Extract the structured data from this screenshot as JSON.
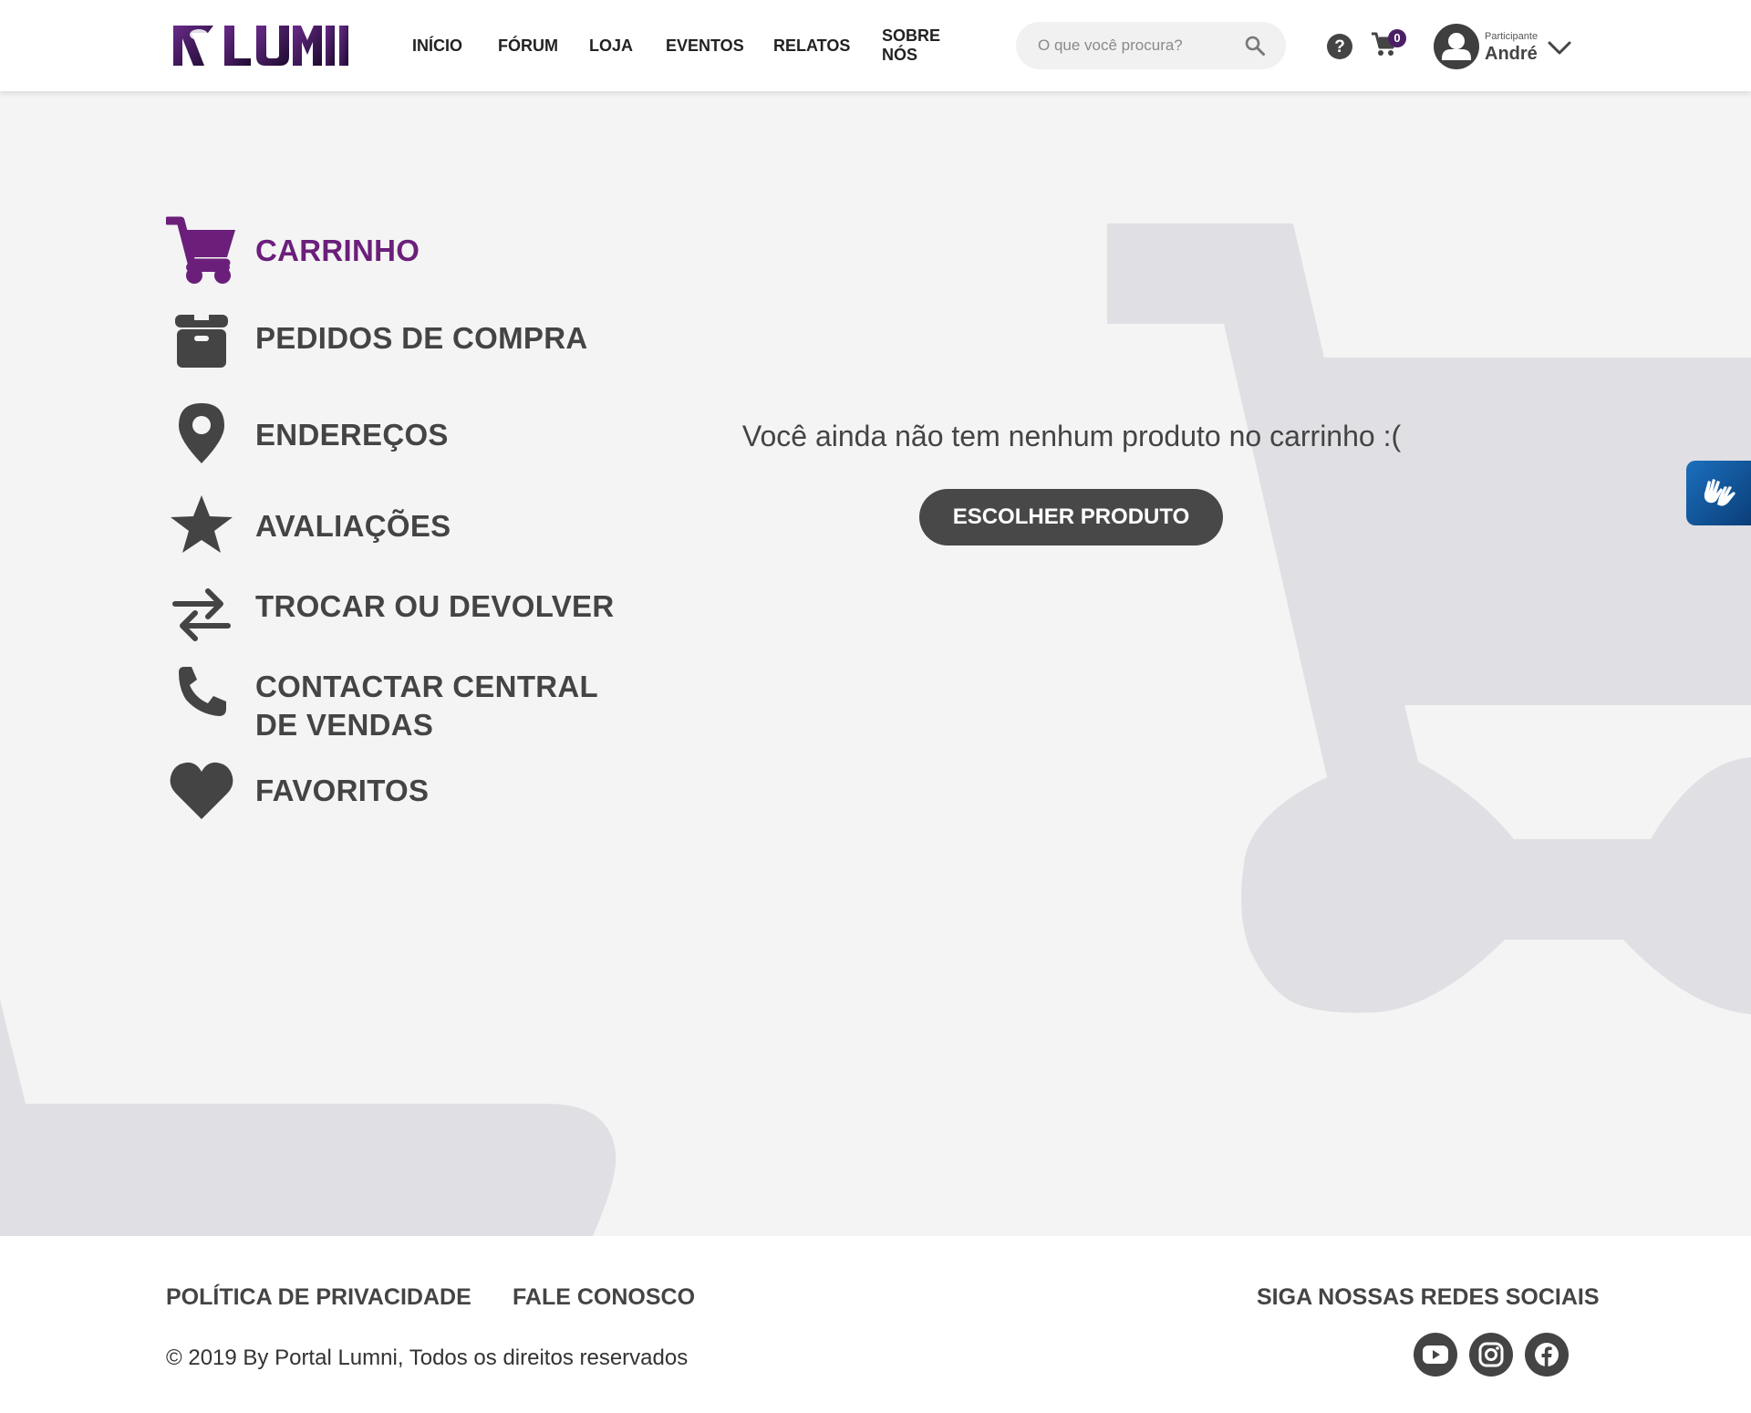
{
  "brand": {
    "logo_text": "LUMNI",
    "brand_color": "#6b1f7a",
    "brand_dark": "#2a0f3a"
  },
  "nav": {
    "items": [
      {
        "label": "INÍCIO"
      },
      {
        "label": "FÓRUM"
      },
      {
        "label": "LOJA"
      },
      {
        "label": "EVENTOS"
      },
      {
        "label": "RELATOS"
      },
      {
        "label": "SOBRE NÓS"
      }
    ]
  },
  "search": {
    "placeholder": "O que você procura?",
    "icon": "search-icon"
  },
  "header_icons": {
    "help": "help-icon",
    "cart": "cart-icon",
    "cart_count": "0"
  },
  "user": {
    "role": "Participante",
    "name": "André"
  },
  "sidebar": {
    "items": [
      {
        "label": "CARRINHO",
        "icon": "cart-icon",
        "active": true
      },
      {
        "label": "PEDIDOS DE COMPRA",
        "icon": "box-icon"
      },
      {
        "label": "ENDEREÇOS",
        "icon": "map-pin-icon"
      },
      {
        "label": "AVALIAÇÕES",
        "icon": "star-icon"
      },
      {
        "label": "TROCAR OU DEVOLVER",
        "icon": "exchange-arrows-icon"
      },
      {
        "label_line1": "CONTACTAR CENTRAL",
        "label_line2": "DE VENDAS",
        "icon": "phone-icon"
      },
      {
        "label": "FAVORITOS",
        "icon": "heart-icon"
      }
    ]
  },
  "main": {
    "empty_message": "Você ainda não tem nenhum produto no carrinho :(",
    "choose_button": "ESCOLHER PRODUTO"
  },
  "accessibility": {
    "icon": "sign-language-hands-icon",
    "color": "#1b6fbd"
  },
  "footer": {
    "privacy": "POLÍTICA DE PRIVACIDADE",
    "contact": "FALE CONOSCO",
    "social_title": "SIGA NOSSAS REDES SOCIAIS",
    "copyright": "© 2019 By Portal Lumni, Todos os direitos reservados",
    "social": [
      "youtube-icon",
      "instagram-icon",
      "facebook-icon"
    ]
  },
  "colors": {
    "background": "#f4f4f4",
    "decor": "#e0dfe3",
    "text": "#444444",
    "active": "#6b1f7a",
    "button": "#484848"
  }
}
